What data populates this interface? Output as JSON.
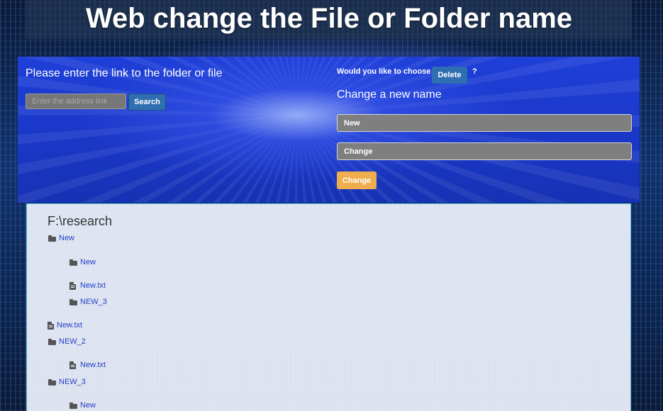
{
  "header": {
    "title": "Web change the File or Folder name"
  },
  "search": {
    "prompt": "Please enter the link to the folder or file",
    "placeholder": "Enter the address link",
    "button_label": "Search"
  },
  "actions": {
    "choose_text": "Would you like to choose",
    "delete_label": "Delete",
    "question_mark": "?",
    "change_heading": "Change a new name",
    "field_new_value": "New",
    "field_change_value": "Change",
    "change_button_label": "Change"
  },
  "tree": {
    "path": "F:\\research",
    "items": [
      {
        "label": "New",
        "type": "folder",
        "depth": 0
      },
      {
        "label": "New",
        "type": "folder",
        "depth": 1
      },
      {
        "label": "New.txt",
        "type": "file",
        "depth": 1
      },
      {
        "label": "NEW_3",
        "type": "folder",
        "depth": 1
      },
      {
        "label": "New.txt",
        "type": "file",
        "depth": 0
      },
      {
        "label": "NEW_2",
        "type": "folder",
        "depth": 0
      },
      {
        "label": "New.txt",
        "type": "file",
        "depth": 1
      },
      {
        "label": "NEW_3",
        "type": "folder",
        "depth": 0
      },
      {
        "label": "New",
        "type": "folder",
        "depth": 1
      }
    ]
  },
  "colors": {
    "search_button": "#2f6eb0",
    "delete_button": "#2f6eb0",
    "change_button": "#f0ad4e",
    "link": "#2540c8",
    "panel_blue": "#1e3fd8"
  }
}
